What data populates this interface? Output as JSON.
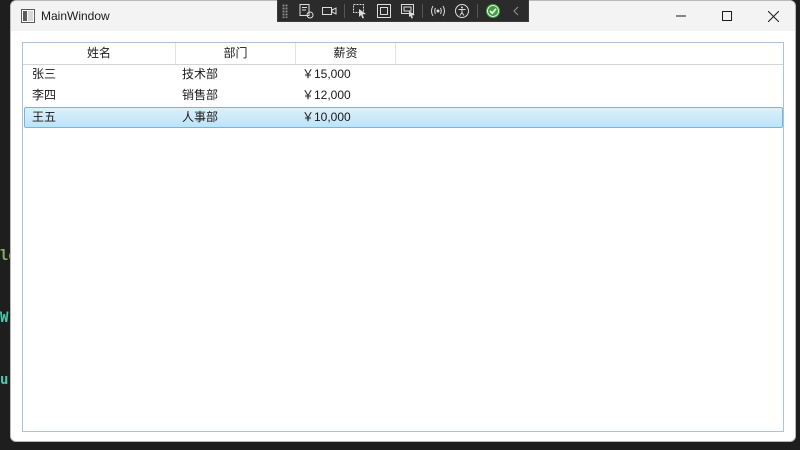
{
  "window": {
    "title": "MainWindow"
  },
  "listview": {
    "columns": [
      {
        "label": "姓名"
      },
      {
        "label": "部门"
      },
      {
        "label": "薪资"
      }
    ],
    "rows": [
      {
        "name": "张三",
        "dept": "技术部",
        "salary": "￥15,000",
        "selected": false
      },
      {
        "name": "李四",
        "dept": "销售部",
        "salary": "￥12,000",
        "selected": false
      },
      {
        "name": "王五",
        "dept": "人事部",
        "salary": "￥10,000",
        "selected": true
      }
    ]
  },
  "debug_toolbar": {
    "icons": [
      "live-visual-tree-icon",
      "record-icon",
      "select-element-icon",
      "display-layout-adorners-icon",
      "track-focus-icon",
      "binding-failures-icon",
      "accessibility-icon",
      "hot-reload-ok-icon",
      "collapse-toolbar-icon"
    ]
  },
  "colors": {
    "selection_border": "#6fb8e4",
    "selection_fill": "#cfeafb",
    "listview_border": "#a9c4dc",
    "background_code": "#4ec9b0"
  }
}
